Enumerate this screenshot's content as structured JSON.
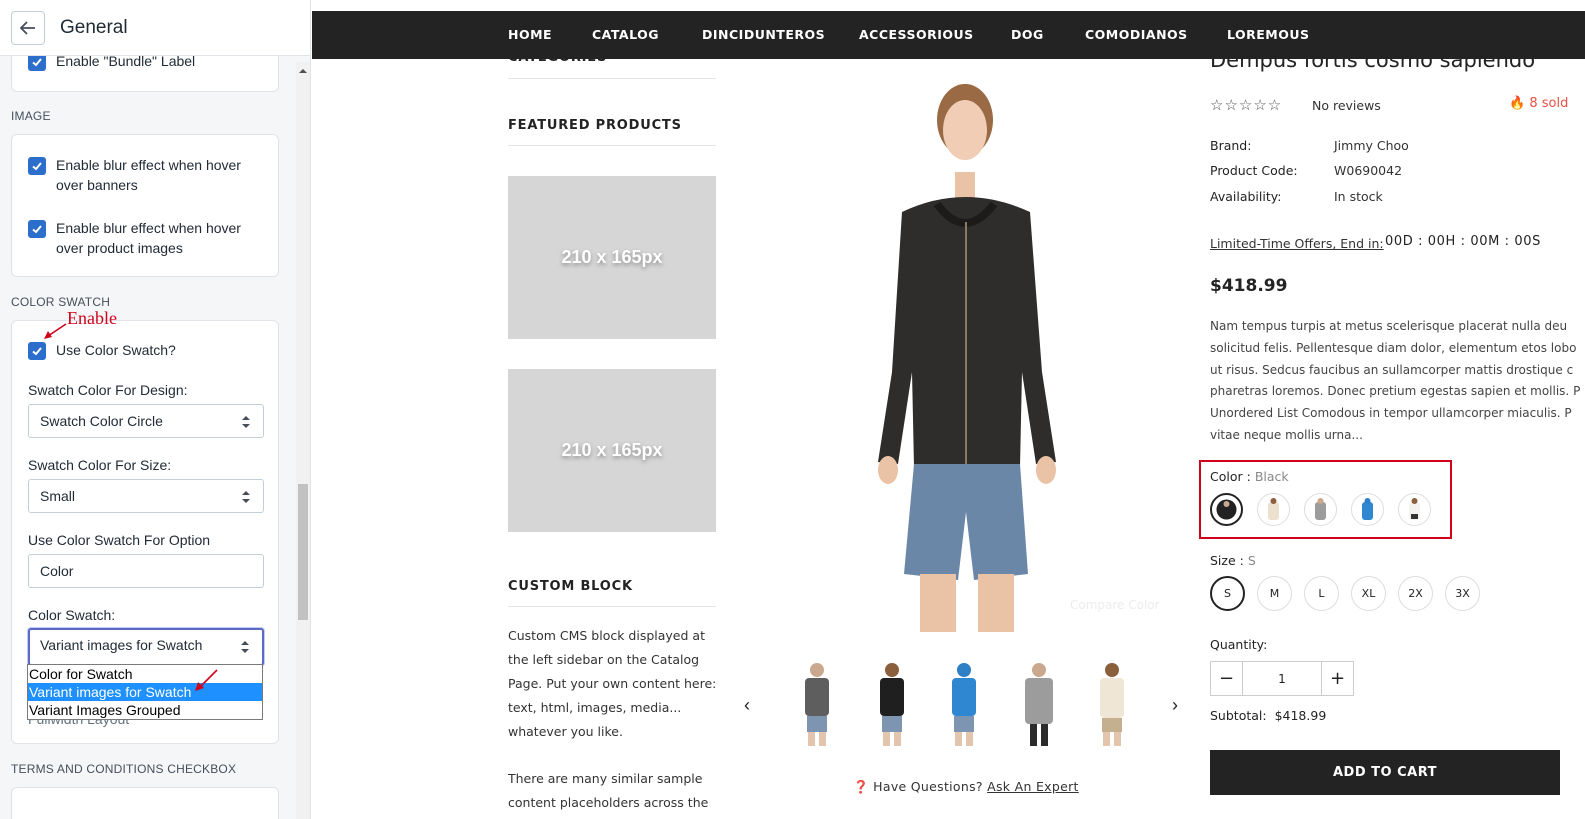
{
  "settings": {
    "title": "General",
    "partial_top_item": "Enable \"Bundle\" Label",
    "image_section": {
      "heading": "IMAGE",
      "options": [
        "Enable blur effect when hover over banners",
        "Enable blur effect when hover over product images"
      ]
    },
    "color_swatch_section": {
      "heading": "COLOR SWATCH",
      "annotation": "Enable",
      "use_color_swatch_label": "Use Color Swatch?",
      "design_label": "Swatch Color For Design:",
      "design_value": "Swatch Color Circle",
      "size_label": "Swatch Color For Size:",
      "size_value": "Small",
      "option_label": "Use Color Swatch For Option",
      "option_value": "Color",
      "swatch_label": "Color Swatch:",
      "swatch_value": "Variant images for Swatch",
      "swatch_options": [
        "Color for Swatch",
        "Variant images for Swatch",
        "Variant Images Grouped"
      ],
      "hidden_partial_text": "Fullwidth Layout"
    },
    "terms_heading": "TERMS AND CONDITIONS CHECKBOX"
  },
  "store": {
    "nav": [
      "HOME",
      "CATALOG",
      "DINCIDUNTEROS",
      "ACCESSORIOUS",
      "DOG",
      "COMODIANOS",
      "LOREMOUS"
    ],
    "sidebar": {
      "categories_heading": "CATEGORIES",
      "featured_heading": "FEATURED PRODUCTS",
      "placeholder_text": "210 x 165px",
      "custom_heading": "CUSTOM BLOCK",
      "custom_text_1": "Custom CMS block displayed at the left sidebar on the Catalog Page. Put your own content here: text, html, images, media... whatever you like.",
      "custom_text_2": "There are many similar sample content placeholders across the"
    },
    "product": {
      "title": "Dempus fortis cosmo sapiendo",
      "reviews": "No reviews",
      "sold": "8 sold",
      "brand_label": "Brand:",
      "brand": "Jimmy Choo",
      "code_label": "Product Code:",
      "code": "W0690042",
      "availability_label": "Availability:",
      "availability": "In stock",
      "offer_label": "Limited-Time Offers, End in:",
      "countdown": "00D : 00H : 00M : 00S",
      "price": "$418.99",
      "description": [
        "Nam tempus turpis at metus scelerisque placerat nulla deu",
        "solicitud felis. Pellentesque diam dolor, elementum etos lobo",
        "ut risus. Sedcus faucibus an sullamcorper mattis drostique c",
        "pharetras loremos. Donec pretium egestas sapien et mollis. P",
        "Unordered List Comodous in tempor ullamcorper miaculis. P",
        "vitae neque mollis urna..."
      ],
      "color_label": "Color :",
      "color_value": "Black",
      "size_label": "Size :",
      "size_value": "S",
      "sizes": [
        "S",
        "M",
        "L",
        "XL",
        "2X",
        "3X"
      ],
      "quantity_label": "Quantity:",
      "quantity": "1",
      "subtotal_label": "Subtotal:",
      "subtotal": "$418.99",
      "add_to_cart": "ADD TO CART",
      "watermark": "Compare Color",
      "help_question": "Have Questions?",
      "help_link": "Ask An Expert"
    }
  },
  "colors": {
    "checkbox": "#2c6ecb",
    "nav_bg": "#232323",
    "annotation": "#d0021b",
    "dropdown_highlight": "#1e90ff",
    "sold_accent": "#e95144"
  }
}
